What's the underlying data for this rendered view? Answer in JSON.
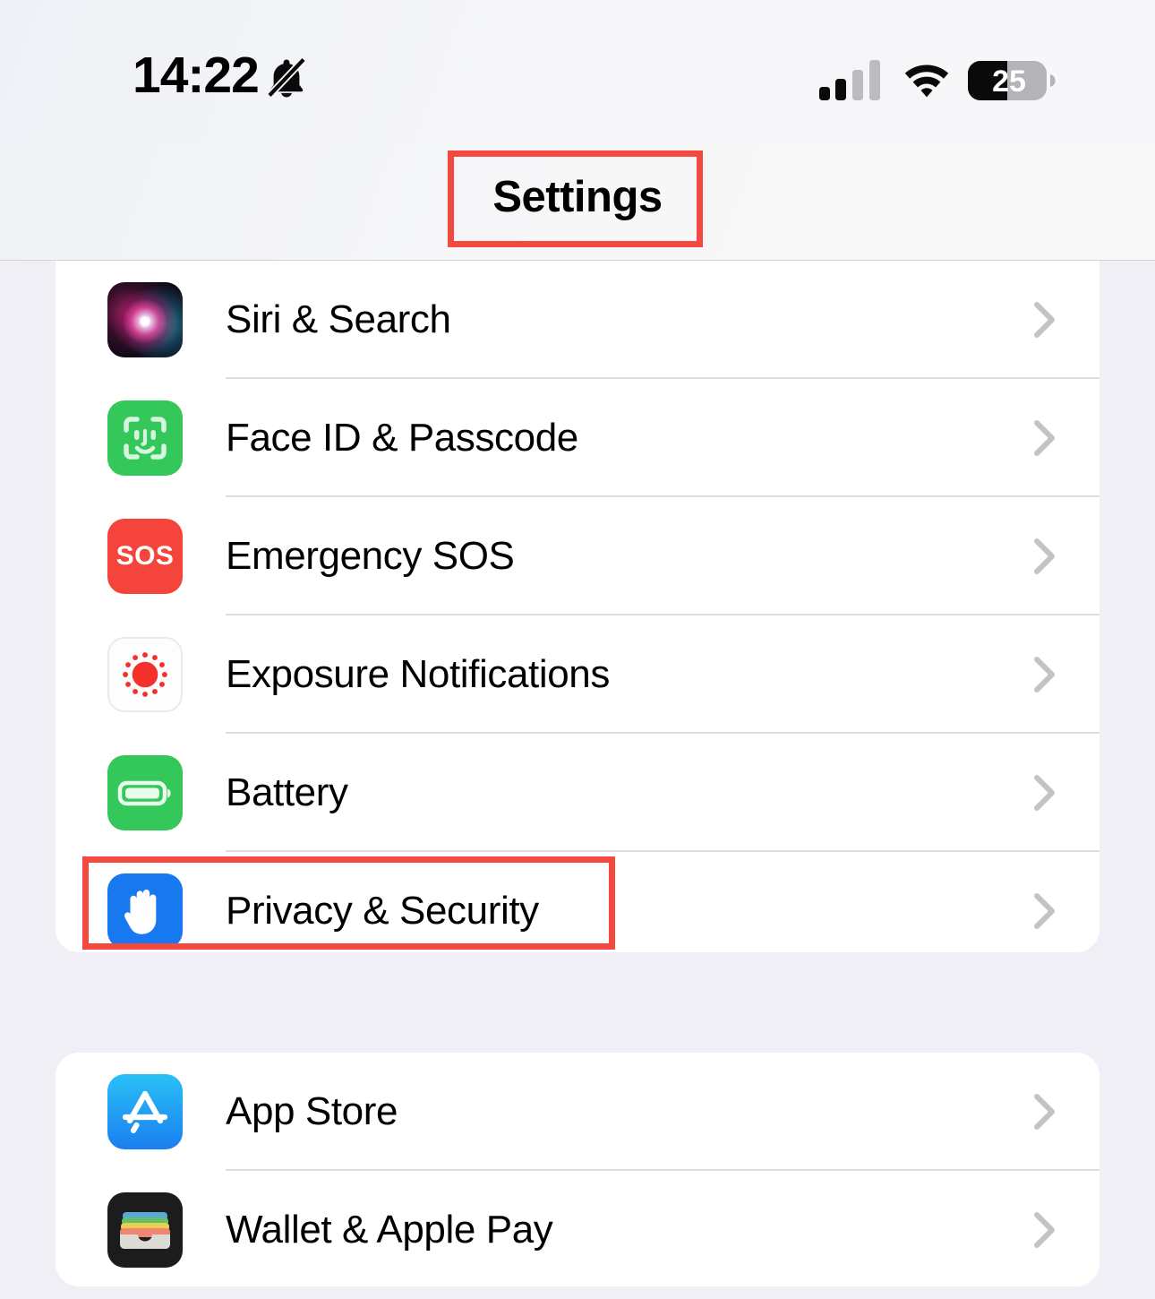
{
  "status_bar": {
    "time": "14:22",
    "bell_icon": "bell-slash-icon",
    "signal_icon": "cellular-signal-icon",
    "signal_bars_filled": 2,
    "signal_bars_total": 4,
    "wifi_icon": "wifi-icon",
    "battery_icon": "battery-icon",
    "battery_percent": "25"
  },
  "header": {
    "title": "Settings"
  },
  "annotations": {
    "title_box_color": "#f4493f",
    "row_box_color": "#f4493f",
    "highlighted_title": "Settings",
    "highlighted_row": "Privacy & Security"
  },
  "sections": [
    {
      "name": "system-section",
      "rows": [
        {
          "label": "Siri & Search",
          "icon": "siri-icon",
          "chevron": "chevron-right-icon"
        },
        {
          "label": "Face ID & Passcode",
          "icon": "face-id-icon",
          "chevron": "chevron-right-icon"
        },
        {
          "label": "Emergency SOS",
          "icon": "emergency-sos-icon",
          "chevron": "chevron-right-icon"
        },
        {
          "label": "Exposure Notifications",
          "icon": "exposure-notifications-icon",
          "chevron": "chevron-right-icon"
        },
        {
          "label": "Battery",
          "icon": "battery-settings-icon",
          "chevron": "chevron-right-icon"
        },
        {
          "label": "Privacy & Security",
          "icon": "privacy-hand-icon",
          "chevron": "chevron-right-icon"
        }
      ]
    },
    {
      "name": "store-section",
      "rows": [
        {
          "label": "App Store",
          "icon": "app-store-icon",
          "chevron": "chevron-right-icon"
        },
        {
          "label": "Wallet & Apple Pay",
          "icon": "wallet-icon",
          "chevron": "chevron-right-icon"
        }
      ]
    }
  ],
  "colors": {
    "background": "#f0eff5",
    "card": "#ffffff",
    "separator": "#dedee2",
    "chevron": "#c2c2c7",
    "accent_red": "#f4493f",
    "green": "#34c759",
    "blue": "#1878f0",
    "sos_red": "#f4443b"
  }
}
